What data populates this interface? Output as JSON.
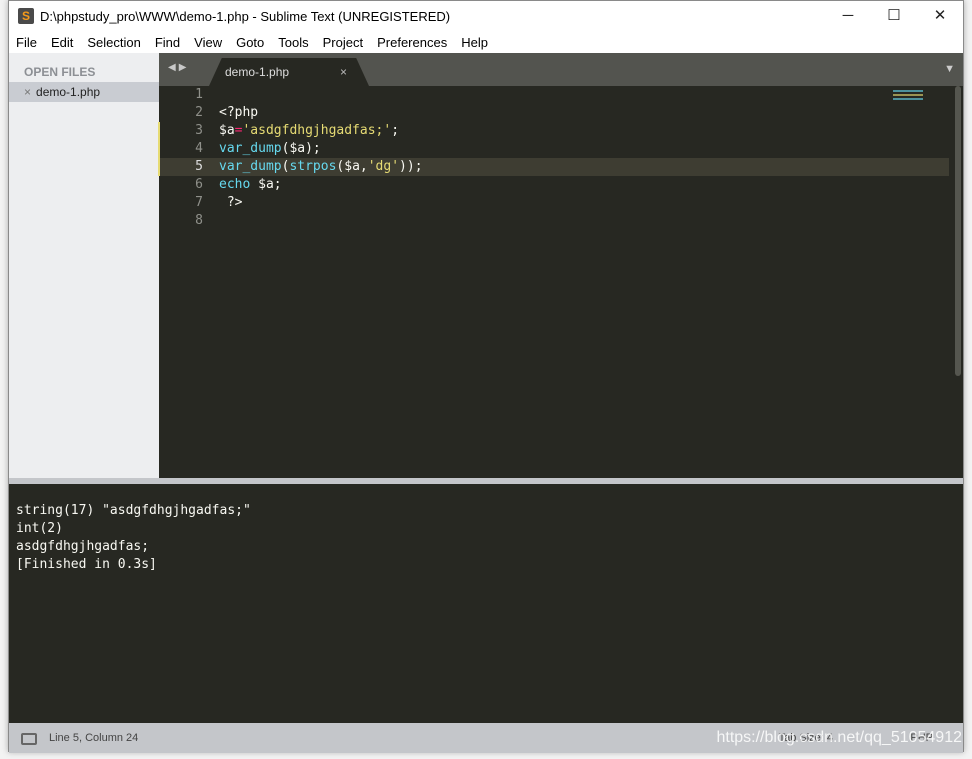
{
  "window": {
    "title": "D:\\phpstudy_pro\\WWW\\demo-1.php - Sublime Text (UNREGISTERED)",
    "minimize": "─",
    "maximize": "☐",
    "close": "✕"
  },
  "menu": [
    "File",
    "Edit",
    "Selection",
    "Find",
    "View",
    "Goto",
    "Tools",
    "Project",
    "Preferences",
    "Help"
  ],
  "sidebar": {
    "header": "OPEN FILES",
    "files": [
      {
        "name": "demo-1.php",
        "close": "×"
      }
    ]
  },
  "tabs": [
    {
      "label": "demo-1.php",
      "close": "×"
    }
  ],
  "editor": {
    "line_numbers": [
      "1",
      "2",
      "3",
      "4",
      "5",
      "6",
      "7",
      "8"
    ],
    "lines": [
      "",
      "<?php",
      "$a='asdgfdhgjhgadfas;';",
      "var_dump($a);",
      "var_dump(strpos($a,'dg'));",
      "echo $a;",
      " ?>",
      ""
    ]
  },
  "output": [
    "string(17) \"asdgfdhgjhgadfas;\"",
    "int(2)",
    "asdgfdhgjhgadfas;",
    "[Finished in 0.3s]"
  ],
  "status": {
    "position": "Line 5, Column 24",
    "tab_size": "Tab Size: 4",
    "syntax": "PHP"
  },
  "watermark": "https://blog.csdn.net/qq_51054912",
  "colors": {
    "editor_bg": "#272822",
    "keyword": "#66d9ef",
    "string": "#e6db74",
    "operator": "#f92672"
  }
}
